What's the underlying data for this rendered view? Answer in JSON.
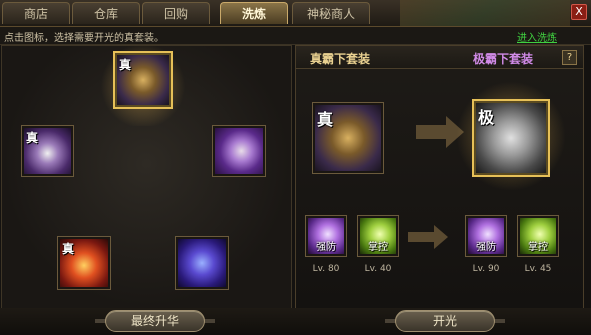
{
  "tabs": [
    {
      "label": "商店"
    },
    {
      "label": "仓库"
    },
    {
      "label": "回购"
    },
    {
      "label": "洗炼"
    },
    {
      "label": "神秘商人"
    }
  ],
  "active_tab": "洗炼",
  "close_label": "X",
  "hint": {
    "text": "点击图标，选择需要开光的真套装。",
    "link": "进入洗炼"
  },
  "left_items": [
    {
      "tag": "真",
      "icon": "golden-kirin-icon"
    },
    {
      "tag": "真",
      "icon": "purple-panda-icon"
    },
    {
      "tag": "",
      "icon": "purple-tiger-icon"
    },
    {
      "tag": "真",
      "icon": "phoenix-icon"
    },
    {
      "tag": "",
      "icon": "blue-dragon-icon"
    }
  ],
  "right": {
    "title_left": "真霸下套装",
    "title_right": "极霸下套装",
    "help": "?",
    "source_tag": "真",
    "target_tag": "极",
    "skills_left": [
      {
        "name": "强防",
        "level": "Lv. 80"
      },
      {
        "name": "掌控",
        "level": "Lv. 40"
      }
    ],
    "skills_right": [
      {
        "name": "强防",
        "level": "Lv. 90"
      },
      {
        "name": "掌控",
        "level": "Lv. 45"
      }
    ]
  },
  "buttons": {
    "final_upgrade": "最终升华",
    "kaiguang": "开光"
  },
  "colors": {
    "accent_gold": "#e6c058",
    "title_purple": "#d08ae6",
    "link_green": "#40d040"
  }
}
